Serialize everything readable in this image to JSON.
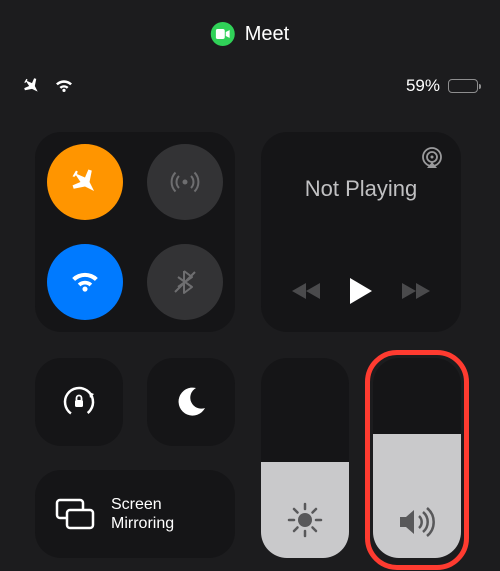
{
  "pill": {
    "app": "Meet"
  },
  "status": {
    "battery_pct": "59%",
    "battery_level": 59,
    "battery_color": "#ffcc00"
  },
  "connectivity": {
    "airplane": {
      "on": true,
      "bg": "#ff9500"
    },
    "cellular": {
      "on": false,
      "bg": "#333335"
    },
    "wifi": {
      "on": true,
      "bg": "#007aff"
    },
    "bluetooth": {
      "on": false,
      "bg": "#333335"
    }
  },
  "media": {
    "title": "Not Playing"
  },
  "screen_mirroring": {
    "label": "Screen\nMirroring"
  },
  "brightness": {
    "level": 48
  },
  "volume": {
    "level": 62,
    "highlighted": true
  }
}
